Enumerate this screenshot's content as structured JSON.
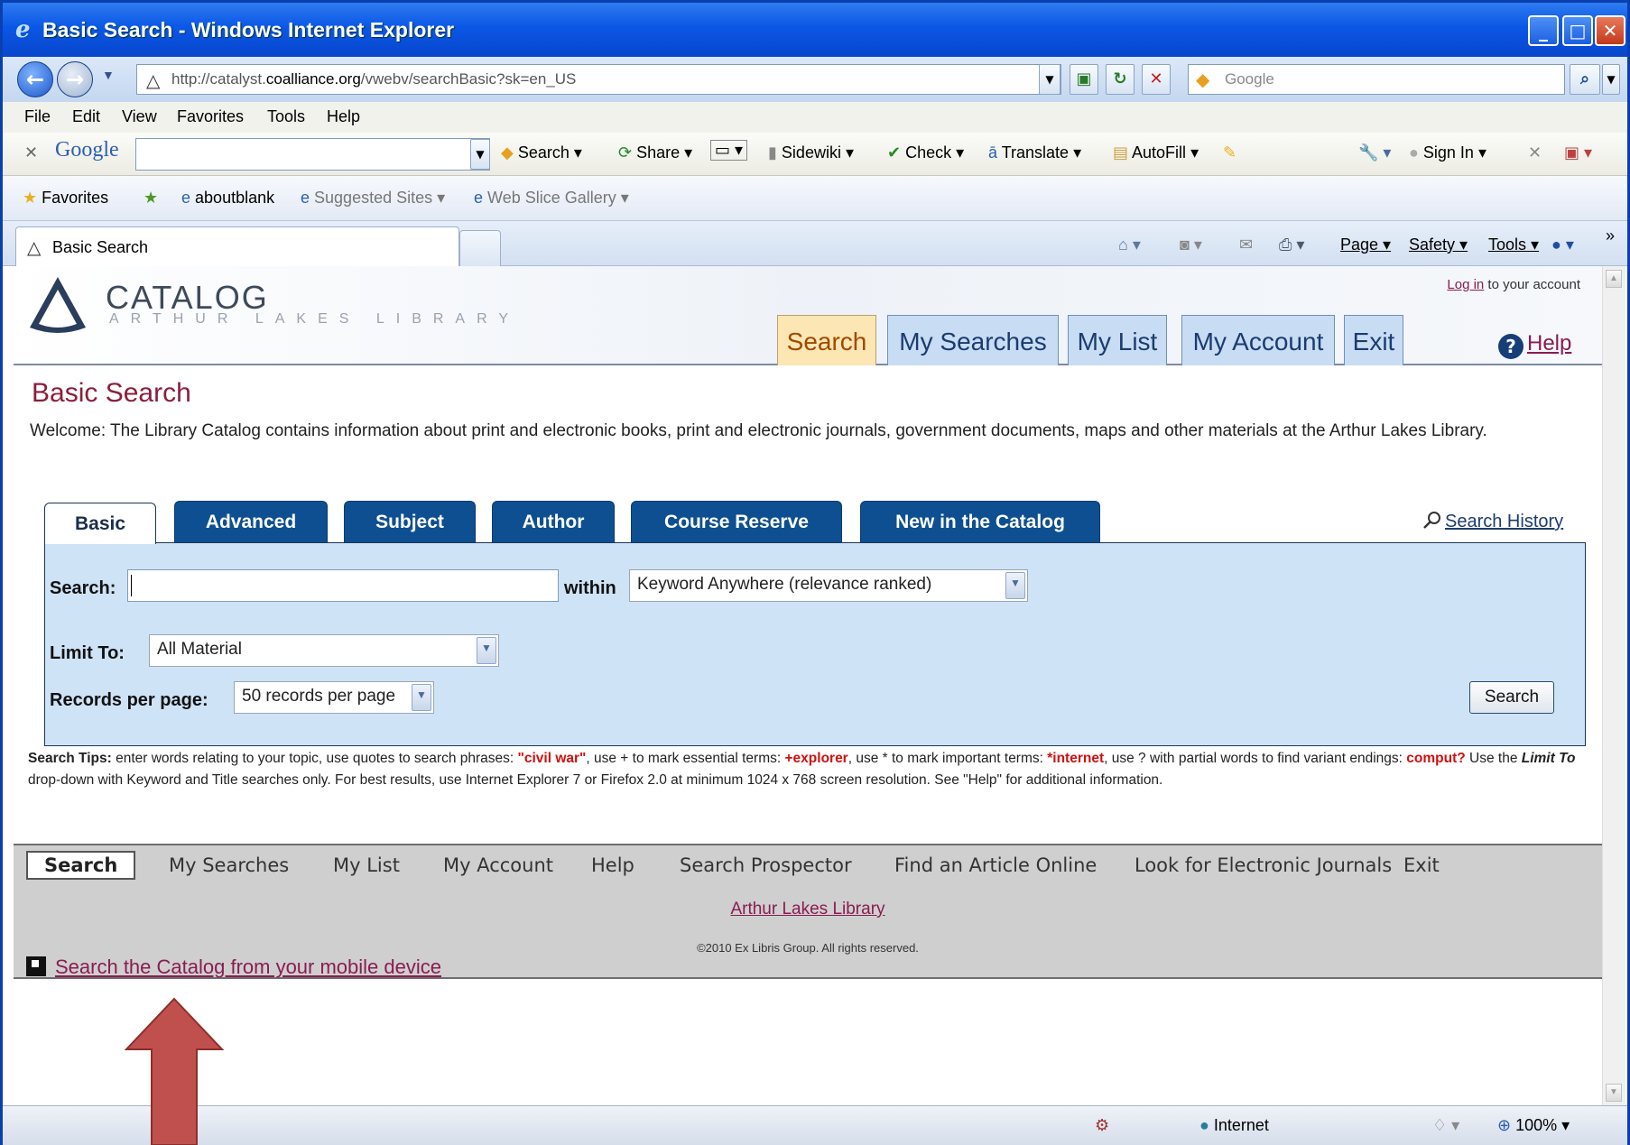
{
  "window": {
    "title": "Basic Search - Windows Internet Explorer"
  },
  "address": {
    "url_prefix": "http://catalyst.",
    "url_domain": "coalliance.org",
    "url_rest": "/vwebv/searchBasic?sk=en_US",
    "search_placeholder": "Google"
  },
  "menu": [
    "File",
    "Edit",
    "View",
    "Favorites",
    "Tools",
    "Help"
  ],
  "google_toolbar": {
    "brand": "Google",
    "search": "Search",
    "share": "Share",
    "sidewiki": "Sidewiki",
    "check": "Check",
    "translate": "Translate",
    "autofill": "AutoFill",
    "sign_in": "Sign In"
  },
  "favorites": {
    "label": "Favorites",
    "items": [
      "aboutblank",
      "Suggested Sites",
      "Web Slice Gallery"
    ]
  },
  "tab": {
    "label": "Basic Search"
  },
  "commands": {
    "page": "Page",
    "safety": "Safety",
    "tools": "Tools"
  },
  "header": {
    "logo_title": "CATALOG",
    "logo_sub": "ARTHUR LAKES LIBRARY",
    "login_link": "Log in",
    "login_text": " to your account",
    "tabs": [
      "Search",
      "My Searches",
      "My List",
      "My Account",
      "Exit"
    ],
    "help": "Help"
  },
  "page": {
    "title": "Basic Search",
    "welcome": "Welcome: The Library Catalog contains information about print and electronic books, print and electronic journals, government documents, maps and other materials at the Arthur Lakes Library."
  },
  "search_tabs": [
    "Basic",
    "Advanced",
    "Subject",
    "Author",
    "Course Reserve",
    "New in the Catalog"
  ],
  "search_history": "Search History",
  "form": {
    "search_label": "Search:",
    "search_value": "",
    "within_label": "within",
    "within_value": "Keyword Anywhere (relevance ranked)",
    "limit_label": "Limit To:",
    "limit_value": "All Material",
    "records_label": "Records per page:",
    "records_value": "50 records per page",
    "submit": "Search"
  },
  "tips": {
    "label": "Search Tips:",
    "t1": " enter words relating to your topic, use quotes to search phrases: ",
    "ex1": "\"civil war\"",
    "t2": ", use + to mark essential terms: ",
    "ex2": "+explorer",
    "t3": ", use * to mark important terms: ",
    "ex3": "*internet",
    "t4": ", use ? with partial words to find variant endings: ",
    "ex4": "comput?",
    "t5": " Use the ",
    "ex5": "Limit To",
    "t6": " drop-down with Keyword and Title searches only. For best results, use Internet Explorer 7 or Firefox 2.0 at minimum 1024 x 768 screen resolution. See \"Help\" for additional information."
  },
  "footer": {
    "nav": [
      "Search",
      "My Searches",
      "My List",
      "My Account",
      "Help",
      "Search Prospector",
      "Find an Article Online",
      "Look for Electronic Journals",
      "Exit"
    ],
    "library_link": "Arthur Lakes Library",
    "copyright": "©2010 Ex Libris Group. All rights reserved.",
    "mobile_link": "Search the Catalog from your mobile device"
  },
  "status": {
    "zone": "Internet",
    "zoom": "100%"
  },
  "colors": {
    "title_bar": "#0a57e6",
    "accent_maroon": "#8a1f3a",
    "tab_blue": "#0e4f91",
    "panel_blue": "#cfe3f7",
    "arrow": "#c0504d"
  }
}
